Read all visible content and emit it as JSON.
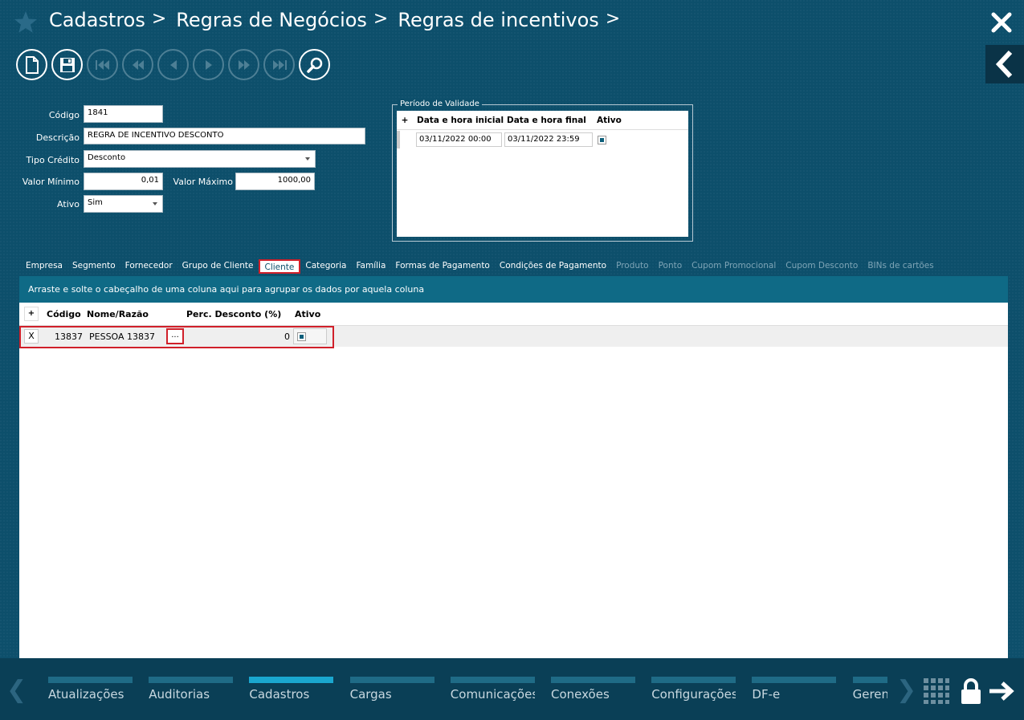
{
  "header": {
    "breadcrumb": [
      "Cadastros",
      "Regras de Negócios",
      "Regras de incentivos"
    ],
    "sep": ">"
  },
  "toolbar": {
    "buttons": [
      "new-document-icon",
      "save-icon",
      "first-record-icon",
      "rewind-icon",
      "previous-icon",
      "next-icon",
      "fast-forward-icon",
      "last-record-icon",
      "search-icon"
    ]
  },
  "form": {
    "codigo_label": "Código",
    "codigo_value": "1841",
    "descricao_label": "Descrição",
    "descricao_value": "REGRA DE INCENTIVO DESCONTO",
    "tipo_credito_label": "Tipo Crédito",
    "tipo_credito_value": "Desconto",
    "valor_minimo_label": "Valor Mínimo",
    "valor_minimo_value": "0,01",
    "valor_maximo_label": "Valor Máximo",
    "valor_maximo_value": "1000,00",
    "ativo_label": "Ativo",
    "ativo_value": "Sim"
  },
  "validade": {
    "legend": "Período de Validade",
    "add": "+",
    "headers": [
      "Data e hora inicial",
      "Data e hora final",
      "Ativo"
    ],
    "row": {
      "inicial": "03/11/2022 00:00",
      "final": "03/11/2022 23:59"
    }
  },
  "tabs": [
    {
      "label": "Empresa"
    },
    {
      "label": "Segmento"
    },
    {
      "label": "Fornecedor"
    },
    {
      "label": "Grupo de Cliente"
    },
    {
      "label": "Cliente"
    },
    {
      "label": "Categoria"
    },
    {
      "label": "Família"
    },
    {
      "label": "Formas de Pagamento"
    },
    {
      "label": "Condições de Pagamento"
    },
    {
      "label": "Produto"
    },
    {
      "label": "Ponto"
    },
    {
      "label": "Cupom Promocional"
    },
    {
      "label": "Cupom Desconto"
    },
    {
      "label": "BINs de cartões"
    }
  ],
  "grid": {
    "group_hint": "Arraste e solte o cabeçalho de uma coluna aqui para agrupar os dados por aquela coluna",
    "add": "+",
    "headers": [
      "Código",
      "Nome/Razão",
      "Perc. Desconto (%)",
      "Ativo"
    ],
    "row": {
      "delete": "X",
      "codigo": "13837",
      "nome": "PESSOA 13837",
      "ellipsis": "...",
      "perc": "0"
    }
  },
  "taskbar": {
    "modules": [
      "Atualizações",
      "Auditorias",
      "Cadastros",
      "Cargas",
      "Comunicações",
      "Conexões",
      "Configurações",
      "DF-e",
      "Gerenciamento"
    ],
    "selected": "Cadastros",
    "prev": "❮",
    "next": "❯"
  },
  "colors": {
    "background": "#0d4f6b",
    "accent": "#1aa7cf",
    "highlight": "#d0202a"
  }
}
